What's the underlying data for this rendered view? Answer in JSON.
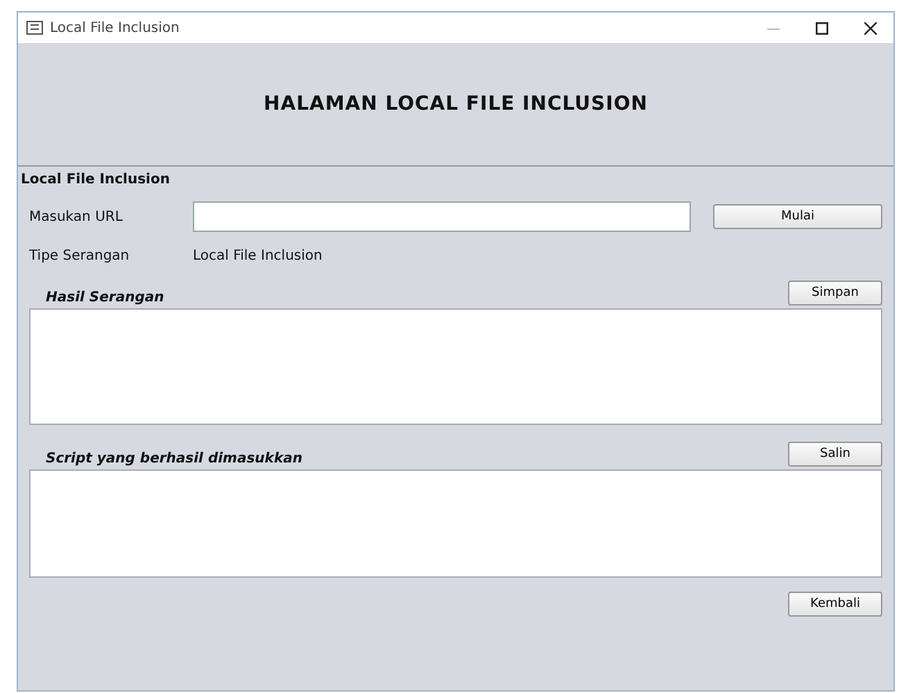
{
  "window": {
    "title": "Local File Inclusion"
  },
  "header": {
    "title": "HALAMAN LOCAL FILE INCLUSION"
  },
  "group": {
    "title": "Local File Inclusion"
  },
  "url_row": {
    "label": "Masukan URL",
    "button": "Mulai"
  },
  "attack_type": {
    "label": "Tipe Serangan",
    "value": "Local File Inclusion"
  },
  "results": {
    "label": "Hasil Serangan",
    "button": "Simpan"
  },
  "scripts": {
    "label": "Script yang berhasil dimasukkan",
    "button": "Salin"
  },
  "footer": {
    "button": "Kembali"
  }
}
